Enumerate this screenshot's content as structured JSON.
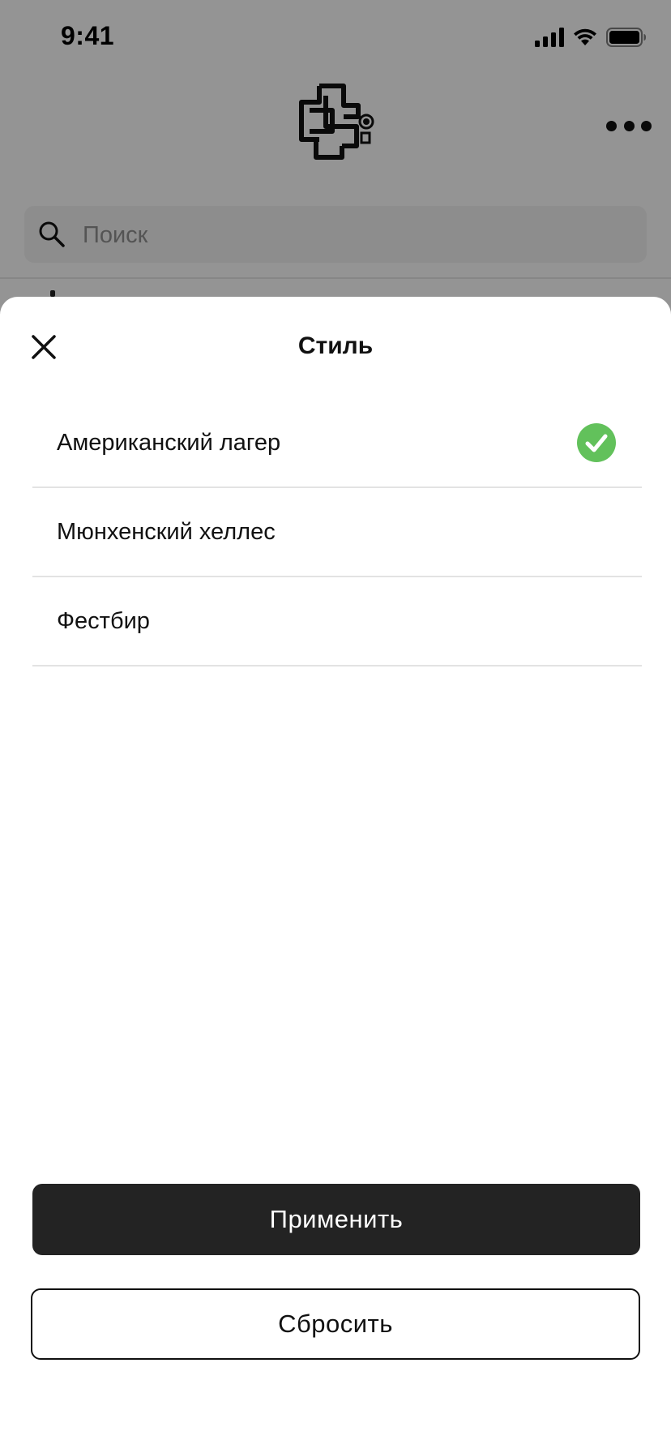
{
  "status_bar": {
    "time": "9:41",
    "icons": [
      "cellular-signal-icon",
      "wifi-icon",
      "battery-icon"
    ]
  },
  "header": {
    "logo_icon": "brewery-monogram-logo-icon",
    "more_icon": "more-horizontal-icon"
  },
  "search": {
    "placeholder": "Поиск",
    "value": "",
    "icon": "search-icon"
  },
  "sheet": {
    "title": "Стиль",
    "close_icon": "close-icon",
    "options": [
      {
        "label": "Американский лагер",
        "selected": true
      },
      {
        "label": "Мюнхенский хеллес",
        "selected": false
      },
      {
        "label": "Фестбир",
        "selected": false
      }
    ],
    "apply_label": "Применить",
    "reset_label": "Сбросить"
  },
  "colors": {
    "overlay": "#000000",
    "check": "#62c15b",
    "apply_bg": "#232323",
    "divider": "#e3e3e3"
  }
}
